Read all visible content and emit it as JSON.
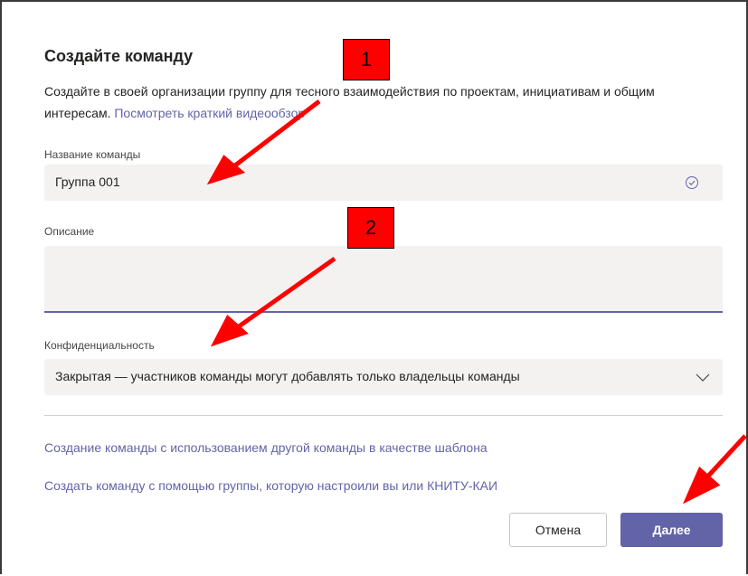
{
  "dialog": {
    "title": "Создайте команду",
    "description": "Создайте в своей организации группу для тесного взаимодействия по проектам, инициативам и общим интересам.",
    "video_link": "Посмотреть краткий видеообзор"
  },
  "form": {
    "team_name_label": "Название команды",
    "team_name_value": "Группа 001",
    "description_label": "Описание",
    "description_value": "",
    "privacy_label": "Конфиденциальность",
    "privacy_value": "Закрытая — участников команды могут добавлять только владельцы команды"
  },
  "links": {
    "template": "Создание команды с использованием другой команды в качестве шаблона",
    "from_group": "Создать команду с помощью группы, которую настроили вы или КНИТУ-КАИ"
  },
  "buttons": {
    "cancel": "Отмена",
    "next": "Далее"
  },
  "annotations": {
    "badge_1": "1",
    "badge_2": "2",
    "color": "#ff0000"
  },
  "colors": {
    "accent": "#6264a7",
    "field_bg": "#f3f2f1"
  }
}
